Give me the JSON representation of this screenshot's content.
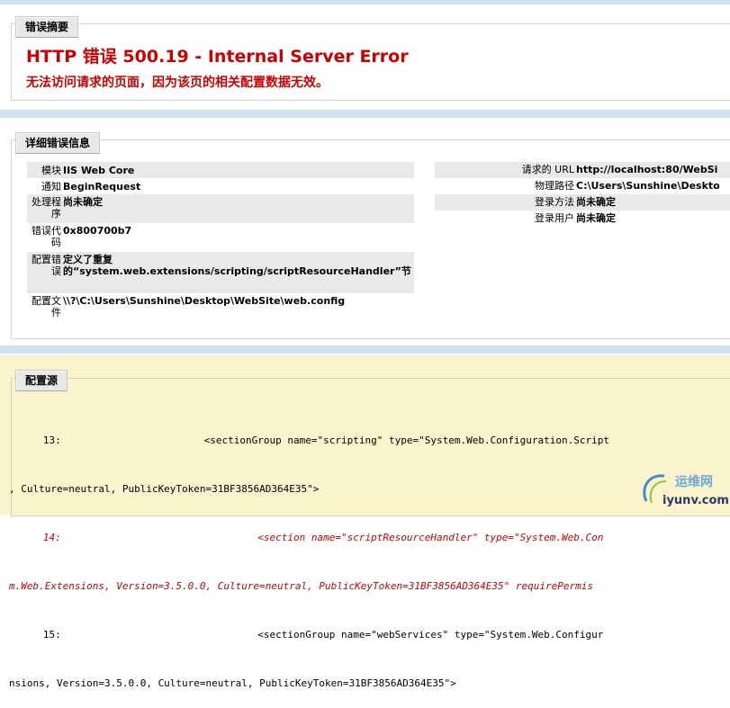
{
  "summary": {
    "legend": "错误摘要",
    "title": "HTTP 错误 500.19 - Internal Server Error",
    "message": "无法访问请求的页面，因为该页的相关配置数据无效。"
  },
  "details": {
    "legend": "详细错误信息",
    "left": [
      {
        "label": "模块",
        "value": "IIS Web Core"
      },
      {
        "label": "通知",
        "value": "BeginRequest"
      },
      {
        "label": "处理程序",
        "value": "尚未确定"
      },
      {
        "label": "错误代码",
        "value": "0x800700b7"
      },
      {
        "label": "配置错误",
        "value": "定义了重复的“system.web.extensions/scripting/scriptResourceHandler”节"
      },
      {
        "label": "配置文件",
        "value": "\\\\?\\C:\\Users\\Sunshine\\Desktop\\WebSite\\web.config"
      }
    ],
    "right": [
      {
        "label": "请求的 URL",
        "value": "http://localhost:80/WebSi"
      },
      {
        "label": "物理路径",
        "value": "C:\\Users\\Sunshine\\Deskto"
      },
      {
        "label": "登录方法",
        "value": "尚未确定"
      },
      {
        "label": "登录用户",
        "value": "尚未确定"
      }
    ]
  },
  "config_source": {
    "legend": "配置源",
    "lines": [
      {
        "text": "   13:                        <sectionGroup name=\"scripting\" type=\"System.Web.Configuration.Script",
        "error": false
      },
      {
        "text": ", Culture=neutral, PublicKeyToken=31BF3856AD364E35\">",
        "error": false
      },
      {
        "text": "   14:                                 <section name=\"scriptResourceHandler\" type=\"System.Web.Con",
        "error": true
      },
      {
        "text": "m.Web.Extensions, Version=3.5.0.0, Culture=neutral, PublicKeyToken=31BF3856AD364E35\" requirePermis",
        "error": true
      },
      {
        "text": "   15:                                 <sectionGroup name=\"webServices\" type=\"System.Web.Configur",
        "error": false
      },
      {
        "text": "nsions, Version=3.5.0.0, Culture=neutral, PublicKeyToken=31BF3856AD364E35\">",
        "error": false
      }
    ]
  },
  "watermark": {
    "cn": "运维网",
    "url": "iyunv.com"
  }
}
